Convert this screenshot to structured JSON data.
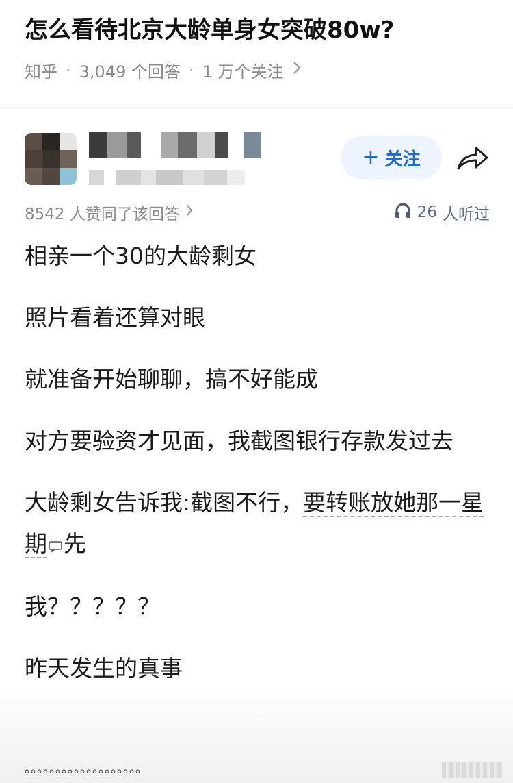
{
  "question": {
    "title": "怎么看待北京大龄单身女突破80w?",
    "source": "知乎",
    "answers": "3,049 个回答",
    "followers": "1 万个关注"
  },
  "author": {
    "follow_label": "关注",
    "upvote_text": "8542 人赞同了该回答",
    "listen_count": "26",
    "listen_label": "人听过"
  },
  "answer": {
    "p1": "相亲一个30的大龄剩女",
    "p2": "照片看着还算对眼",
    "p3": "就准备开始聊聊，搞不好能成",
    "p4": "对方要验资才见面，我截图银行存款发过去",
    "p5_a": "大龄剩女告诉我:截图不行，",
    "p5_underlined": "要转账放她那一星期",
    "p5_b": "先",
    "p6": "我？？？？？",
    "p7": "昨天发生的真事",
    "dots": "。。。。。。。。。。。。。。。。。。。"
  },
  "colors": {
    "accent": "#1e6bd6",
    "follow_bg": "#eef4fd",
    "meta": "#8a8a8a"
  },
  "icons": [
    "chevron-right-icon",
    "headphones-icon",
    "share-icon",
    "comment-bubble-icon"
  ]
}
